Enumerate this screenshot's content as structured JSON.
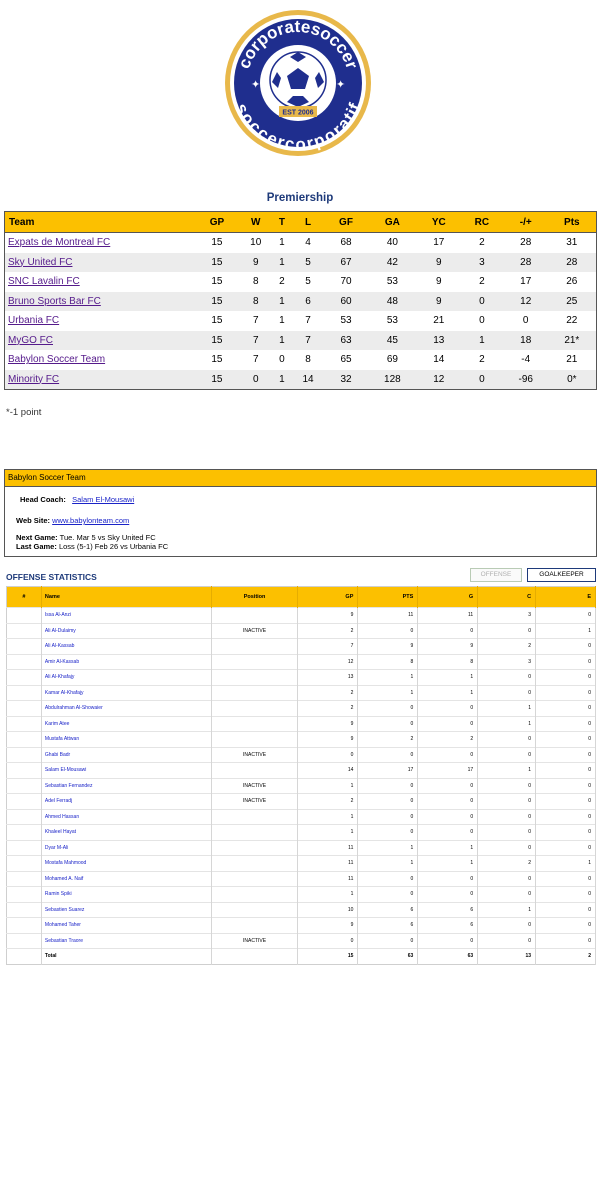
{
  "logo": {
    "top_text": "corporatesoccer",
    "bottom_text": "soccercorporatif",
    "est": "EST 2006"
  },
  "league": {
    "title": "Premiership"
  },
  "standings": {
    "headers": [
      "Team",
      "GP",
      "W",
      "T",
      "L",
      "GF",
      "GA",
      "YC",
      "RC",
      "-/+",
      "Pts"
    ],
    "rows": [
      [
        "Expats de Montreal FC",
        "15",
        "10",
        "1",
        "4",
        "68",
        "40",
        "17",
        "2",
        "28",
        "31"
      ],
      [
        "Sky United FC",
        "15",
        "9",
        "1",
        "5",
        "67",
        "42",
        "9",
        "3",
        "28",
        "28"
      ],
      [
        "SNC Lavalin FC",
        "15",
        "8",
        "2",
        "5",
        "70",
        "53",
        "9",
        "2",
        "17",
        "26"
      ],
      [
        "Bruno Sports Bar FC",
        "15",
        "8",
        "1",
        "6",
        "60",
        "48",
        "9",
        "0",
        "12",
        "25"
      ],
      [
        "Urbania FC",
        "15",
        "7",
        "1",
        "7",
        "53",
        "53",
        "21",
        "0",
        "0",
        "22"
      ],
      [
        "MyGO FC",
        "15",
        "7",
        "1",
        "7",
        "63",
        "45",
        "13",
        "1",
        "18",
        "21*"
      ],
      [
        "Babylon Soccer Team",
        "15",
        "7",
        "0",
        "8",
        "65",
        "69",
        "14",
        "2",
        "-4",
        "21"
      ],
      [
        "Minority FC",
        "15",
        "0",
        "1",
        "14",
        "32",
        "128",
        "12",
        "0",
        "-96",
        "0*"
      ]
    ],
    "footnote": "*-1 point"
  },
  "team": {
    "name": "Babylon Soccer Team",
    "coach_label": "Head Coach:",
    "coach": "Salam El-Mousawi",
    "web_label": "Web Site:",
    "web": "www.babylonteam.com",
    "next_label": "Next Game:",
    "next": "Tue. Mar 5 vs Sky United FC",
    "last_label": "Last Game:",
    "last": "Loss (5-1) Feb 26 vs Urbania FC"
  },
  "offense": {
    "title": "OFFENSE STATISTICS",
    "tab_offense": "OFFENSE",
    "tab_goalkeeper": "GOALKEEPER",
    "headers": [
      "#",
      "Name",
      "Position",
      "GP",
      "PTS",
      "G",
      "C",
      "E"
    ],
    "rows": [
      [
        "",
        "Issa Al-Anzi",
        "",
        "9",
        "11",
        "11",
        "3",
        "0"
      ],
      [
        "",
        "Ali Al-Dulaimy",
        "INACTIVE",
        "2",
        "0",
        "0",
        "0",
        "1"
      ],
      [
        "",
        "Ali Al-Kassab",
        "",
        "7",
        "9",
        "9",
        "2",
        "0"
      ],
      [
        "",
        "Amir Al-Kassab",
        "",
        "12",
        "8",
        "8",
        "3",
        "0"
      ],
      [
        "",
        "Ali Al-Khafajy",
        "",
        "13",
        "1",
        "1",
        "0",
        "0"
      ],
      [
        "",
        "Kamar Al-Khafajy",
        "",
        "2",
        "1",
        "1",
        "0",
        "0"
      ],
      [
        "",
        "Abdulrahman Al-Showaier",
        "",
        "2",
        "0",
        "0",
        "1",
        "0"
      ],
      [
        "",
        "Karim Atee",
        "",
        "9",
        "0",
        "0",
        "1",
        "0"
      ],
      [
        "",
        "Mustafa Attwan",
        "",
        "9",
        "2",
        "2",
        "0",
        "0"
      ],
      [
        "",
        "Ghabi Badr",
        "INACTIVE",
        "0",
        "0",
        "0",
        "0",
        "0"
      ],
      [
        "",
        "Salam El-Mousawi",
        "",
        "14",
        "17",
        "17",
        "1",
        "0"
      ],
      [
        "",
        "Sebastian Fernandez",
        "INACTIVE",
        "1",
        "0",
        "0",
        "0",
        "0"
      ],
      [
        "",
        "Adel Ferradj",
        "INACTIVE",
        "2",
        "0",
        "0",
        "0",
        "0"
      ],
      [
        "",
        "Ahmed Hassan",
        "",
        "1",
        "0",
        "0",
        "0",
        "0"
      ],
      [
        "",
        "Khaleel Hayat",
        "",
        "1",
        "0",
        "0",
        "0",
        "0"
      ],
      [
        "",
        "Dyar M-Ali",
        "",
        "11",
        "1",
        "1",
        "0",
        "0"
      ],
      [
        "",
        "Mostafa Mahmood",
        "",
        "11",
        "1",
        "1",
        "2",
        "1"
      ],
      [
        "",
        "Mohamed A. Naif",
        "",
        "11",
        "0",
        "0",
        "0",
        "0"
      ],
      [
        "",
        "Ramin Spiki",
        "",
        "1",
        "0",
        "0",
        "0",
        "0"
      ],
      [
        "",
        "Sebastien Suarez",
        "",
        "10",
        "6",
        "6",
        "1",
        "0"
      ],
      [
        "",
        "Mohamed Taher",
        "",
        "9",
        "6",
        "6",
        "0",
        "0"
      ],
      [
        "",
        "Sebastian Traore",
        "INACTIVE",
        "0",
        "0",
        "0",
        "0",
        "0"
      ]
    ],
    "total": [
      "",
      "Total",
      "",
      "15",
      "63",
      "63",
      "13",
      "2"
    ]
  },
  "colors": {
    "header_yellow": "#fcc000",
    "navy": "#1e3a7a",
    "link_blue": "#1a23c8",
    "link_visited": "#551a8b",
    "logo_gold": "#e8b84a"
  }
}
